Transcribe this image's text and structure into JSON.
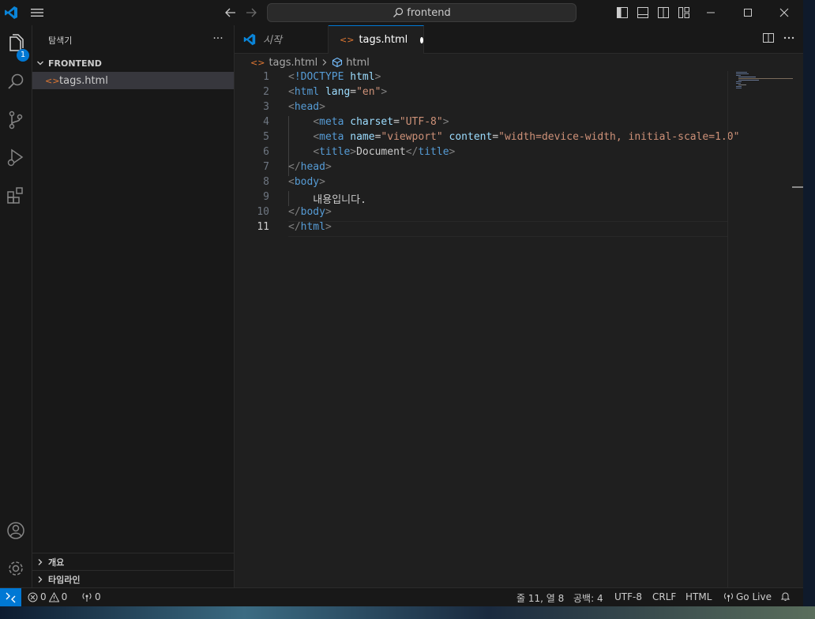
{
  "titlebar": {
    "search_text": "frontend"
  },
  "activity": {
    "explorer_badge": "1"
  },
  "sidebar": {
    "title": "탐색기",
    "more": "···",
    "folder": "FRONTEND",
    "file": "tags.html",
    "sections": [
      "개요",
      "타임라인"
    ]
  },
  "tabs": [
    {
      "label": "시작",
      "icon": "vscode-logo-icon"
    },
    {
      "label": "tags.html",
      "icon": "html-file-icon",
      "dirty": true
    }
  ],
  "breadcrumb": {
    "file": "tags.html",
    "symbol": "html"
  },
  "editor": {
    "lines": [
      {
        "n": "1",
        "tokens": [
          [
            "br",
            "<"
          ],
          [
            "tag",
            "!DOCTYPE"
          ],
          [
            "txt",
            " "
          ],
          [
            "attr",
            "html"
          ],
          [
            "br",
            ">"
          ]
        ]
      },
      {
        "n": "2",
        "tokens": [
          [
            "br",
            "<"
          ],
          [
            "tag",
            "html"
          ],
          [
            "txt",
            " "
          ],
          [
            "attr",
            "lang"
          ],
          [
            "txt",
            "="
          ],
          [
            "str",
            "\"en\""
          ],
          [
            "br",
            ">"
          ]
        ]
      },
      {
        "n": "3",
        "tokens": [
          [
            "br",
            "<"
          ],
          [
            "tag",
            "head"
          ],
          [
            "br",
            ">"
          ]
        ]
      },
      {
        "n": "4",
        "tokens": [
          [
            "txt",
            "    "
          ],
          [
            "br",
            "<"
          ],
          [
            "tag",
            "meta"
          ],
          [
            "txt",
            " "
          ],
          [
            "attr",
            "charset"
          ],
          [
            "txt",
            "="
          ],
          [
            "str",
            "\"UTF-8\""
          ],
          [
            "br",
            ">"
          ]
        ]
      },
      {
        "n": "5",
        "tokens": [
          [
            "txt",
            "    "
          ],
          [
            "br",
            "<"
          ],
          [
            "tag",
            "meta"
          ],
          [
            "txt",
            " "
          ],
          [
            "attr",
            "name"
          ],
          [
            "txt",
            "="
          ],
          [
            "str",
            "\"viewport\""
          ],
          [
            "txt",
            " "
          ],
          [
            "attr",
            "content"
          ],
          [
            "txt",
            "="
          ],
          [
            "str",
            "\"width=device-width, initial-scale=1.0\""
          ]
        ]
      },
      {
        "n": "6",
        "tokens": [
          [
            "txt",
            "    "
          ],
          [
            "br",
            "<"
          ],
          [
            "tag",
            "title"
          ],
          [
            "br",
            ">"
          ],
          [
            "txt",
            "Document"
          ],
          [
            "br",
            "</"
          ],
          [
            "tag",
            "title"
          ],
          [
            "br",
            ">"
          ]
        ]
      },
      {
        "n": "7",
        "tokens": [
          [
            "br",
            "</"
          ],
          [
            "tag",
            "head"
          ],
          [
            "br",
            ">"
          ]
        ]
      },
      {
        "n": "8",
        "tokens": [
          [
            "br",
            "<"
          ],
          [
            "tag",
            "body"
          ],
          [
            "br",
            ">"
          ]
        ]
      },
      {
        "n": "9",
        "tokens": [
          [
            "txt",
            "    내용입니다."
          ]
        ]
      },
      {
        "n": "10",
        "tokens": [
          [
            "br",
            "</"
          ],
          [
            "tag",
            "body"
          ],
          [
            "br",
            ">"
          ]
        ]
      },
      {
        "n": "11",
        "tokens": [
          [
            "br",
            "</"
          ],
          [
            "tag",
            "html"
          ],
          [
            "br",
            ">"
          ]
        ]
      }
    ],
    "current_line": "11"
  },
  "status": {
    "errors": "0",
    "warnings": "0",
    "ports": "0",
    "position": "줄 11, 열 8",
    "spaces": "공백: 4",
    "encoding": "UTF-8",
    "eol": "CRLF",
    "language": "HTML",
    "golive": "Go Live"
  }
}
